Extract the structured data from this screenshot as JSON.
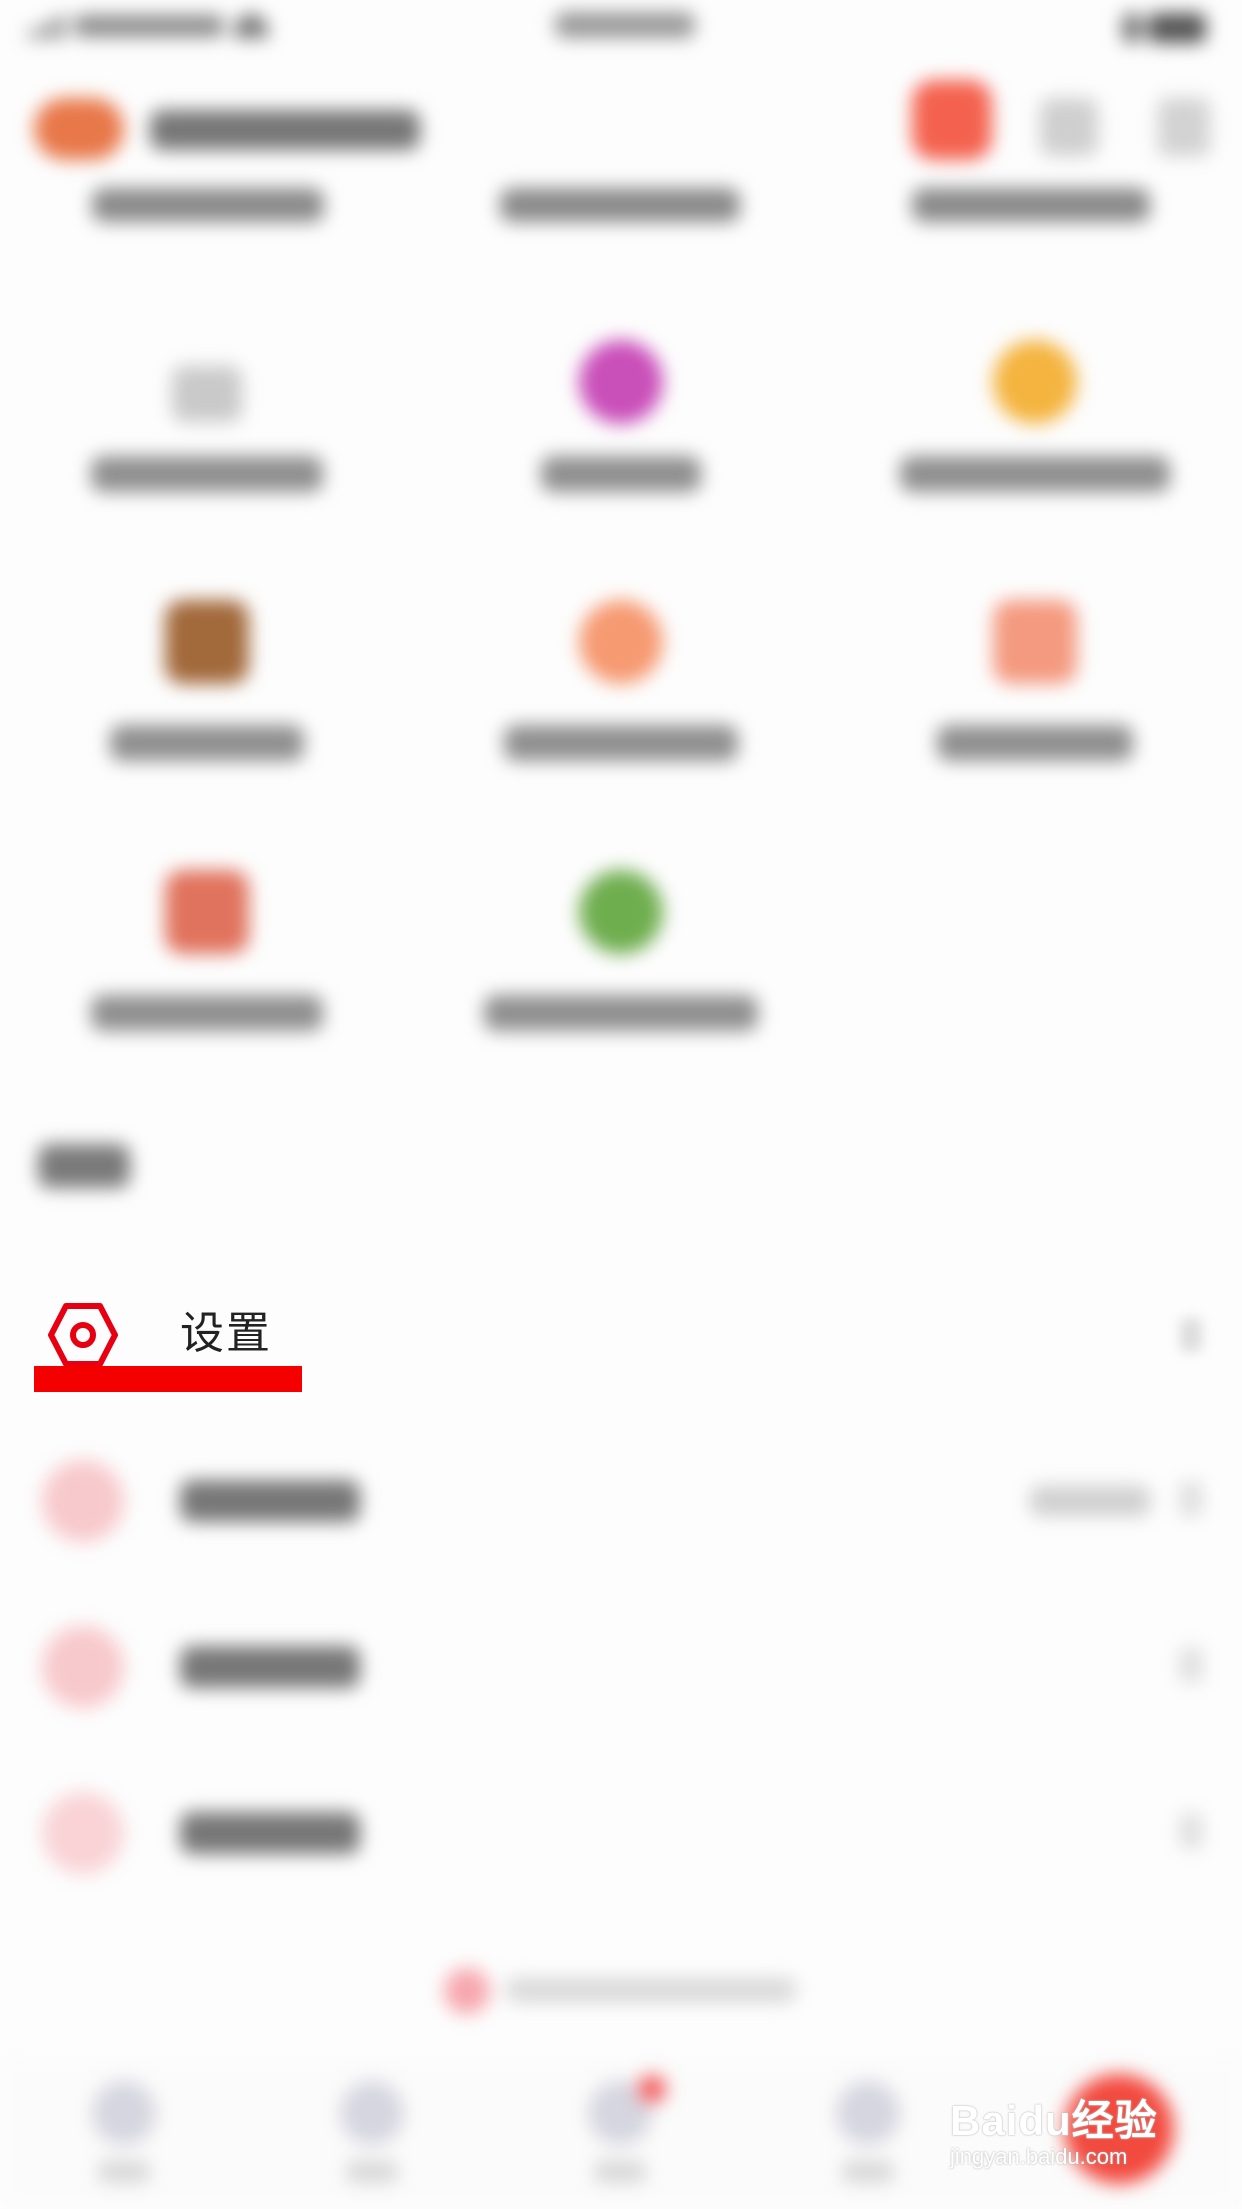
{
  "settings_row": {
    "label": "设置"
  },
  "watermark": {
    "logo": "Baidu经验",
    "url": "jingyan.baidu.com"
  },
  "colors": {
    "accent_red": "#f40000",
    "settings_icon": "#e60012",
    "background": "#fdfdfd"
  },
  "icons": {
    "settings": "gear-hexagon-icon",
    "chevron": "chevron-right-icon"
  }
}
